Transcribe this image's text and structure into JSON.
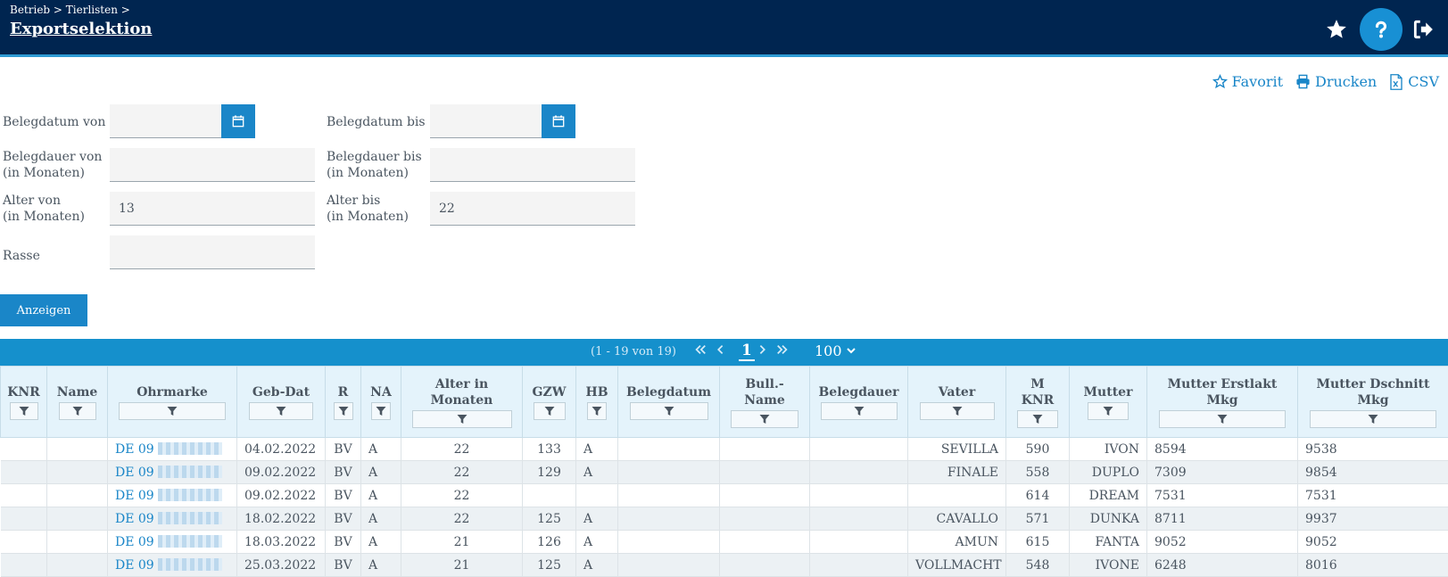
{
  "header": {
    "breadcrumb": "Betrieb > Tierlisten >",
    "title": "Exportselektion",
    "icons": [
      "star-icon",
      "help-icon",
      "logout-icon"
    ]
  },
  "toolbar": {
    "favorit": "Favorit",
    "drucken": "Drucken",
    "csv": "CSV"
  },
  "form": {
    "belegdatum_von": {
      "label": "Belegdatum von",
      "value": ""
    },
    "belegdatum_bis": {
      "label": "Belegdatum bis",
      "value": ""
    },
    "belegdauer_von": {
      "label1": "Belegdauer von",
      "label2": "(in Monaten)",
      "value": ""
    },
    "belegdauer_bis": {
      "label1": "Belegdauer bis",
      "label2": "(in Monaten)",
      "value": ""
    },
    "alter_von": {
      "label1": "Alter von",
      "label2": "(in Monaten)",
      "value": "13"
    },
    "alter_bis": {
      "label1": "Alter bis",
      "label2": "(in Monaten)",
      "value": "22"
    },
    "rasse": {
      "label": "Rasse",
      "value": ""
    },
    "submit": "Anzeigen"
  },
  "paginator": {
    "report": "(1 - 19 von 19)",
    "current_page": "1",
    "rows_per_page": "100"
  },
  "table": {
    "columns": [
      {
        "h1": "KNR",
        "h2": ""
      },
      {
        "h1": "Name",
        "h2": ""
      },
      {
        "h1": "Ohrmarke",
        "h2": ""
      },
      {
        "h1": "Geb-Dat",
        "h2": ""
      },
      {
        "h1": "R",
        "h2": ""
      },
      {
        "h1": "NA",
        "h2": ""
      },
      {
        "h1": "Alter in",
        "h2": "Monaten"
      },
      {
        "h1": "GZW",
        "h2": ""
      },
      {
        "h1": "HB",
        "h2": ""
      },
      {
        "h1": "Belegdatum",
        "h2": ""
      },
      {
        "h1": "Bull.-",
        "h2": "Name"
      },
      {
        "h1": "Belegdauer",
        "h2": ""
      },
      {
        "h1": "Vater",
        "h2": ""
      },
      {
        "h1": "M",
        "h2": "KNR"
      },
      {
        "h1": "Mutter",
        "h2": ""
      },
      {
        "h1": "Mutter Erstlakt",
        "h2": "Mkg"
      },
      {
        "h1": "Mutter Dschnitt",
        "h2": "Mkg"
      }
    ],
    "rows": [
      {
        "knr": "",
        "name": "",
        "ohrmarke": "DE 09",
        "geb": "04.02.2022",
        "r": "BV",
        "na": "A",
        "alter": "22",
        "gzw": "133",
        "hb": "A",
        "belegdatum": "",
        "bull": "",
        "belegdauer": "",
        "vater": "SEVILLA",
        "mknr": "590",
        "mutter": "IVON",
        "erstlakt": "8594",
        "dschnitt": "9538"
      },
      {
        "knr": "",
        "name": "",
        "ohrmarke": "DE 09",
        "geb": "09.02.2022",
        "r": "BV",
        "na": "A",
        "alter": "22",
        "gzw": "129",
        "hb": "A",
        "belegdatum": "",
        "bull": "",
        "belegdauer": "",
        "vater": "FINALE",
        "mknr": "558",
        "mutter": "DUPLO",
        "erstlakt": "7309",
        "dschnitt": "9854"
      },
      {
        "knr": "",
        "name": "",
        "ohrmarke": "DE 09",
        "geb": "09.02.2022",
        "r": "BV",
        "na": "A",
        "alter": "22",
        "gzw": "",
        "hb": "",
        "belegdatum": "",
        "bull": "",
        "belegdauer": "",
        "vater": "",
        "mknr": "614",
        "mutter": "DREAM",
        "erstlakt": "7531",
        "dschnitt": "7531"
      },
      {
        "knr": "",
        "name": "",
        "ohrmarke": "DE 09",
        "geb": "18.02.2022",
        "r": "BV",
        "na": "A",
        "alter": "22",
        "gzw": "125",
        "hb": "A",
        "belegdatum": "",
        "bull": "",
        "belegdauer": "",
        "vater": "CAVALLO",
        "mknr": "571",
        "mutter": "DUNKA",
        "erstlakt": "8711",
        "dschnitt": "9937"
      },
      {
        "knr": "",
        "name": "",
        "ohrmarke": "DE 09",
        "geb": "18.03.2022",
        "r": "BV",
        "na": "A",
        "alter": "21",
        "gzw": "126",
        "hb": "A",
        "belegdatum": "",
        "bull": "",
        "belegdauer": "",
        "vater": "AMUN",
        "mknr": "615",
        "mutter": "FANTA",
        "erstlakt": "9052",
        "dschnitt": "9052"
      },
      {
        "knr": "",
        "name": "",
        "ohrmarke": "DE 09",
        "geb": "25.03.2022",
        "r": "BV",
        "na": "A",
        "alter": "21",
        "gzw": "125",
        "hb": "A",
        "belegdatum": "",
        "bull": "",
        "belegdauer": "",
        "vater": "VOLLMACHT",
        "mknr": "548",
        "mutter": "IVONE",
        "erstlakt": "6248",
        "dschnitt": "8016"
      }
    ]
  }
}
